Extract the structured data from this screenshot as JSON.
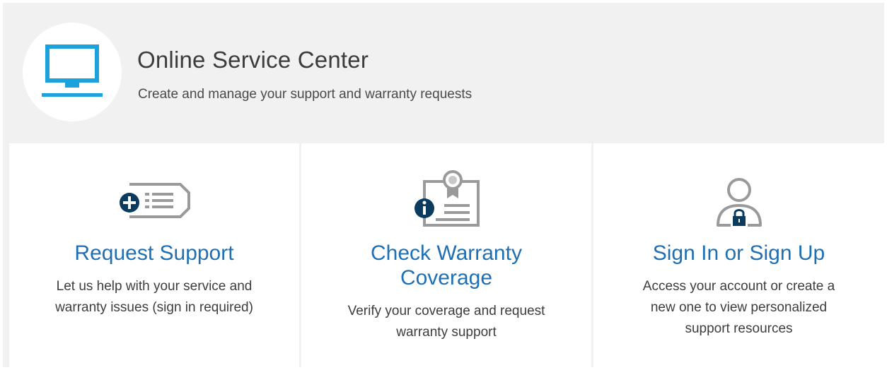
{
  "header": {
    "title": "Online Service Center",
    "subtitle": "Create and manage your support and warranty requests",
    "icon": "monitor-icon"
  },
  "colors": {
    "accent_blue": "#1f6fb3",
    "icon_cyan": "#1ba1dc",
    "icon_dark": "#0b3b5e",
    "icon_gray": "#9a9a9a",
    "background": "#f1f1f1"
  },
  "cards": [
    {
      "title_lines": [
        "Request Support"
      ],
      "desc_lines": [
        "Let us help with your service and",
        "warranty issues (sign in required)"
      ],
      "icon": "request-support-icon"
    },
    {
      "title_lines": [
        "Check Warranty",
        "Coverage"
      ],
      "desc_lines": [
        "Verify your coverage and request",
        "warranty support"
      ],
      "icon": "warranty-certificate-icon"
    },
    {
      "title_lines": [
        "Sign In or Sign Up"
      ],
      "desc_lines": [
        "Access your account or create a",
        "new one to view personalized",
        "support resources"
      ],
      "icon": "user-lock-icon"
    }
  ]
}
